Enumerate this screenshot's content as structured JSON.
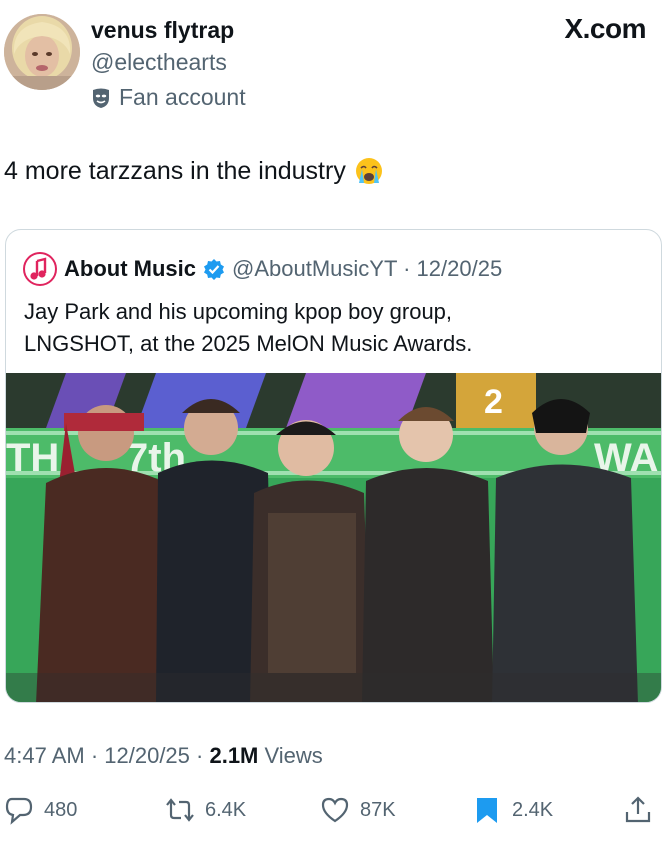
{
  "author": {
    "display_name": "venus flytrap",
    "handle": "@electhearts",
    "badge_label": "Fan account"
  },
  "brand": "X.com",
  "tweet": {
    "text": "4 more tarzzans in the industry",
    "emoji": "loudly-crying-face"
  },
  "quote": {
    "name": "About Music",
    "meta": "@AboutMusicYT · 12/20/25",
    "text_line1": "Jay Park and his upcoming kpop boy group,",
    "text_line2": "LNGSHOT, at the 2025 MelON Music Awards.",
    "photo_sign_left": "TH",
    "photo_sign_mid": "7th",
    "photo_sign_right": "WAR",
    "photo_sign_num": "2"
  },
  "meta": {
    "time": "4:47 AM · 12/20/25 · ",
    "views_count": "2.1M",
    "views_label": " Views"
  },
  "actions": {
    "replies": "480",
    "reposts": "6.4K",
    "likes": "87K",
    "bookmarks": "2.4K"
  },
  "colors": {
    "text": "#0f1419",
    "secondary": "#536471",
    "border": "#cfd9de",
    "bookmark": "#1d9bf0",
    "verified": "#1d9bf0"
  }
}
